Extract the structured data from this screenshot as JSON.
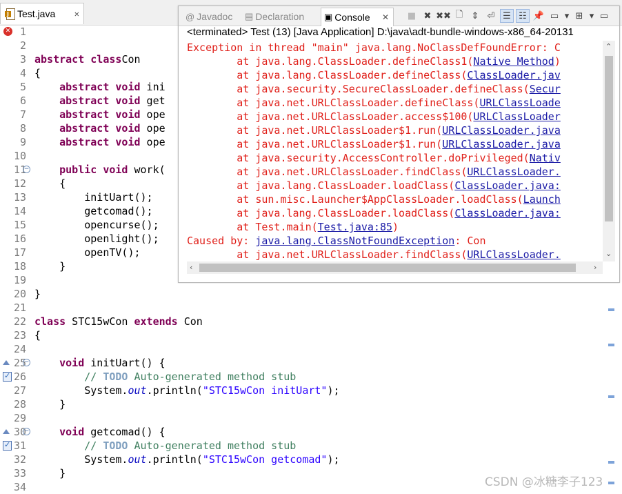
{
  "editor": {
    "tab_label": "Test.java",
    "lines": [
      {
        "n": "1",
        "marker": "error",
        "fold": "",
        "code": []
      },
      {
        "n": "2",
        "marker": "",
        "fold": "",
        "code": []
      },
      {
        "n": "3",
        "marker": "",
        "fold": "",
        "code": [
          [
            "kw",
            "abstract class"
          ],
          [
            "",
            "Con"
          ]
        ]
      },
      {
        "n": "4",
        "marker": "",
        "fold": "",
        "code": [
          [
            "",
            "{"
          ]
        ]
      },
      {
        "n": "5",
        "marker": "",
        "fold": "",
        "code": [
          [
            "",
            "    "
          ],
          [
            "kw",
            "abstract void"
          ],
          [
            "",
            " ini"
          ]
        ]
      },
      {
        "n": "6",
        "marker": "",
        "fold": "",
        "code": [
          [
            "",
            "    "
          ],
          [
            "kw",
            "abstract void"
          ],
          [
            "",
            " get"
          ]
        ]
      },
      {
        "n": "7",
        "marker": "",
        "fold": "",
        "code": [
          [
            "",
            "    "
          ],
          [
            "kw",
            "abstract void"
          ],
          [
            "",
            " ope"
          ]
        ]
      },
      {
        "n": "8",
        "marker": "",
        "fold": "",
        "code": [
          [
            "",
            "    "
          ],
          [
            "kw",
            "abstract void"
          ],
          [
            "",
            " ope"
          ]
        ]
      },
      {
        "n": "9",
        "marker": "",
        "fold": "",
        "code": [
          [
            "",
            "    "
          ],
          [
            "kw",
            "abstract void"
          ],
          [
            "",
            " ope"
          ]
        ]
      },
      {
        "n": "10",
        "marker": "",
        "fold": "",
        "code": []
      },
      {
        "n": "11",
        "marker": "",
        "fold": "minus",
        "code": [
          [
            "",
            "    "
          ],
          [
            "kw",
            "public void"
          ],
          [
            "",
            " work("
          ]
        ]
      },
      {
        "n": "12",
        "marker": "",
        "fold": "",
        "code": [
          [
            "",
            "    {"
          ]
        ]
      },
      {
        "n": "13",
        "marker": "",
        "fold": "",
        "code": [
          [
            "",
            "        initUart();"
          ]
        ]
      },
      {
        "n": "14",
        "marker": "",
        "fold": "",
        "code": [
          [
            "",
            "        getcomad();"
          ]
        ]
      },
      {
        "n": "15",
        "marker": "",
        "fold": "",
        "code": [
          [
            "",
            "        opencurse();"
          ]
        ]
      },
      {
        "n": "16",
        "marker": "",
        "fold": "",
        "code": [
          [
            "",
            "        openlight();"
          ]
        ]
      },
      {
        "n": "17",
        "marker": "",
        "fold": "",
        "code": [
          [
            "",
            "        openTV();"
          ]
        ]
      },
      {
        "n": "18",
        "marker": "",
        "fold": "",
        "code": [
          [
            "",
            "    }"
          ]
        ]
      },
      {
        "n": "19",
        "marker": "",
        "fold": "",
        "code": []
      },
      {
        "n": "20",
        "marker": "",
        "fold": "",
        "code": [
          [
            "",
            "}"
          ]
        ]
      },
      {
        "n": "21",
        "marker": "",
        "fold": "",
        "code": []
      },
      {
        "n": "22",
        "marker": "",
        "fold": "",
        "code": [
          [
            "kw",
            "class"
          ],
          [
            "",
            " STC15wCon "
          ],
          [
            "kw",
            "extends"
          ],
          [
            "",
            " Con"
          ]
        ]
      },
      {
        "n": "23",
        "marker": "",
        "fold": "",
        "code": [
          [
            "",
            "{"
          ]
        ]
      },
      {
        "n": "24",
        "marker": "",
        "fold": "",
        "code": []
      },
      {
        "n": "25",
        "marker": "override",
        "fold": "minus",
        "code": [
          [
            "",
            "    "
          ],
          [
            "kw",
            "void"
          ],
          [
            "",
            " initUart() {"
          ]
        ]
      },
      {
        "n": "26",
        "marker": "implement",
        "fold": "",
        "code": [
          [
            "",
            "        "
          ],
          [
            "cm",
            "// "
          ],
          [
            "todo",
            "TODO"
          ],
          [
            "cm",
            " Auto-generated method stub"
          ]
        ]
      },
      {
        "n": "27",
        "marker": "",
        "fold": "",
        "code": [
          [
            "",
            "        System."
          ],
          [
            "fld",
            "out"
          ],
          [
            "",
            ".println("
          ],
          [
            "str",
            "\"STC15wCon initUart\""
          ],
          [
            "",
            ");"
          ]
        ]
      },
      {
        "n": "28",
        "marker": "",
        "fold": "",
        "code": [
          [
            "",
            "    }"
          ]
        ]
      },
      {
        "n": "29",
        "marker": "",
        "fold": "",
        "code": []
      },
      {
        "n": "30",
        "marker": "override",
        "fold": "minus",
        "code": [
          [
            "",
            "    "
          ],
          [
            "kw",
            "void"
          ],
          [
            "",
            " getcomad() {"
          ]
        ]
      },
      {
        "n": "31",
        "marker": "implement",
        "fold": "",
        "code": [
          [
            "",
            "        "
          ],
          [
            "cm",
            "// "
          ],
          [
            "todo",
            "TODO"
          ],
          [
            "cm",
            " Auto-generated method stub"
          ]
        ]
      },
      {
        "n": "32",
        "marker": "",
        "fold": "",
        "code": [
          [
            "",
            "        System."
          ],
          [
            "fld",
            "out"
          ],
          [
            "",
            ".println("
          ],
          [
            "str",
            "\"STC15wCon getcomad\""
          ],
          [
            "",
            ");"
          ]
        ]
      },
      {
        "n": "33",
        "marker": "",
        "fold": "",
        "code": [
          [
            "",
            "    }"
          ]
        ]
      },
      {
        "n": "34",
        "marker": "",
        "fold": "",
        "code": []
      }
    ]
  },
  "console": {
    "tabs": [
      {
        "label": "Javadoc",
        "icon": "at-icon",
        "active": false
      },
      {
        "label": "Declaration",
        "icon": "declaration-icon",
        "active": false
      },
      {
        "label": "Console",
        "icon": "console-icon",
        "active": true
      }
    ],
    "toolbar": [
      "terminate-icon",
      "remove-launch-icon",
      "remove-all-launches-icon",
      "clear-console-icon",
      "scroll-lock-icon",
      "word-wrap-icon",
      "show-on-stdout-icon",
      "show-on-stderr-icon",
      "pin-console-icon",
      "display-console-icon",
      "dropdown-icon",
      "open-console-icon",
      "dropdown-icon",
      "minimize-icon"
    ],
    "header": "<terminated> Test (13) [Java Application] D:\\java\\adt-bundle-windows-x86_64-20131",
    "output": [
      [
        [
          "t",
          "Exception in thread \"main\" java.lang.NoClassDefFoundError: C"
        ]
      ],
      [
        [
          "t",
          "        at java.lang.ClassLoader.defineClass1("
        ],
        [
          "l",
          "Native Method"
        ],
        [
          "t",
          ")"
        ]
      ],
      [
        [
          "t",
          "        at java.lang.ClassLoader.defineClass("
        ],
        [
          "l",
          "ClassLoader.jav"
        ]
      ],
      [
        [
          "t",
          "        at java.security.SecureClassLoader.defineClass("
        ],
        [
          "l",
          "Secur"
        ]
      ],
      [
        [
          "t",
          "        at java.net.URLClassLoader.defineClass("
        ],
        [
          "l",
          "URLClassLoade"
        ]
      ],
      [
        [
          "t",
          "        at java.net.URLClassLoader.access$100("
        ],
        [
          "l",
          "URLClassLoader"
        ]
      ],
      [
        [
          "t",
          "        at java.net.URLClassLoader$1.run("
        ],
        [
          "l",
          "URLClassLoader.java"
        ]
      ],
      [
        [
          "t",
          "        at java.net.URLClassLoader$1.run("
        ],
        [
          "l",
          "URLClassLoader.java"
        ]
      ],
      [
        [
          "t",
          "        at java.security.AccessController.doPrivileged("
        ],
        [
          "l",
          "Nativ"
        ]
      ],
      [
        [
          "t",
          "        at java.net.URLClassLoader.findClass("
        ],
        [
          "l",
          "URLClassLoader."
        ]
      ],
      [
        [
          "t",
          "        at java.lang.ClassLoader.loadClass("
        ],
        [
          "l",
          "ClassLoader.java:"
        ]
      ],
      [
        [
          "t",
          "        at sun.misc.Launcher$AppClassLoader.loadClass("
        ],
        [
          "l",
          "Launch"
        ]
      ],
      [
        [
          "t",
          "        at java.lang.ClassLoader.loadClass("
        ],
        [
          "l",
          "ClassLoader.java:"
        ]
      ],
      [
        [
          "t",
          "        at Test.main("
        ],
        [
          "l",
          "Test.java:85"
        ],
        [
          "t",
          ")"
        ]
      ],
      [
        [
          "t",
          "Caused by: "
        ],
        [
          "l",
          "java.lang.ClassNotFoundException"
        ],
        [
          "t",
          ": Con"
        ]
      ],
      [
        [
          "t",
          "        at java.net.URLClassLoader.findClass("
        ],
        [
          "l",
          "URLClassLoader."
        ]
      ]
    ]
  },
  "watermark": "CSDN @冰糖李子123",
  "colors": {
    "keyword": "#7f0055",
    "comment": "#3f7f5f",
    "string": "#2a00ff",
    "error_text": "#e0201a",
    "link": "#1a1aa6"
  }
}
